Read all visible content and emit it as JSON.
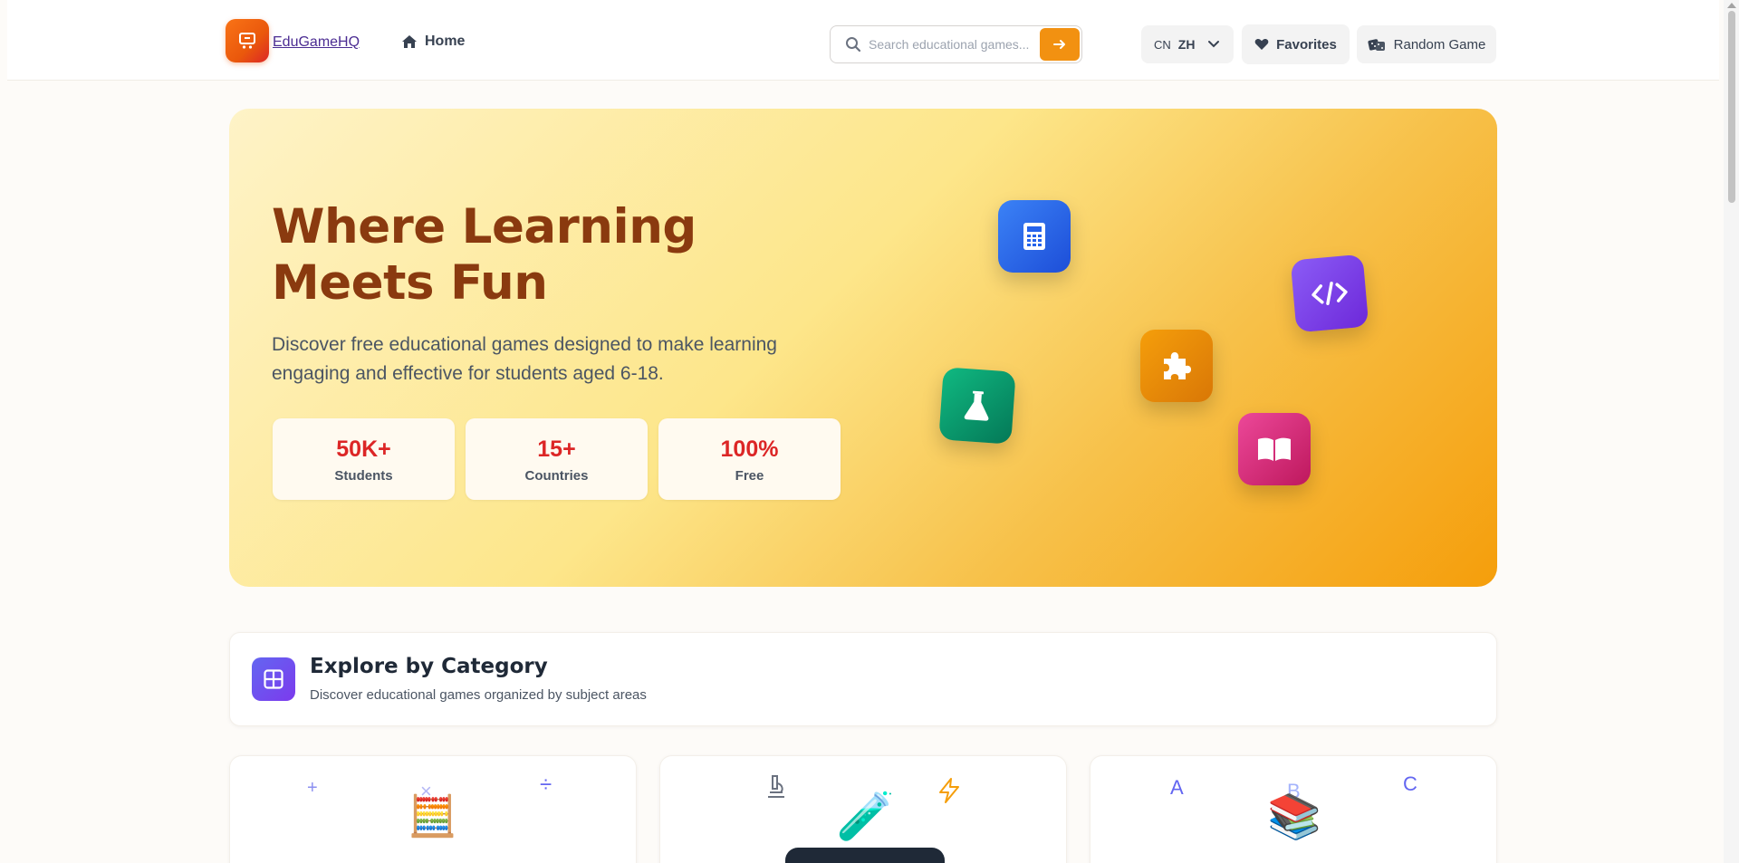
{
  "header": {
    "brand": "EduGameHQ",
    "home_label": "Home",
    "search_placeholder": "Search educational games...",
    "lang_flag": "CN",
    "lang_code": "ZH",
    "favorites_label": "Favorites",
    "random_label": "Random Game"
  },
  "hero": {
    "title": "Where Learning Meets Fun",
    "subtitle": "Discover free educational games designed to make learning engaging and effective for students aged 6-18.",
    "stats": [
      {
        "value": "50K+",
        "label": "Students"
      },
      {
        "value": "15+",
        "label": "Countries"
      },
      {
        "value": "100%",
        "label": "Free"
      }
    ],
    "floating_icons": [
      "calculator-icon",
      "code-icon",
      "puzzle-icon",
      "flask-icon",
      "book-icon"
    ]
  },
  "categories": {
    "title": "Explore by Category",
    "subtitle": "Discover educational games organized by subject areas",
    "cards": [
      {
        "name": "math",
        "symbols": [
          "+",
          "×",
          "÷"
        ],
        "emoji": "🧮"
      },
      {
        "name": "science",
        "emoji": "🧪"
      },
      {
        "name": "language",
        "symbols": [
          "A",
          "B",
          "C"
        ],
        "emoji": "📚"
      }
    ]
  },
  "colors": {
    "accent": "#f29111",
    "hero_title": "#8a3a0f",
    "stat_value": "#dc2626",
    "calculator": "#2563eb",
    "code": "#7c3aed",
    "puzzle": "#e27d0e",
    "flask": "#059669",
    "book": "#db2777"
  }
}
